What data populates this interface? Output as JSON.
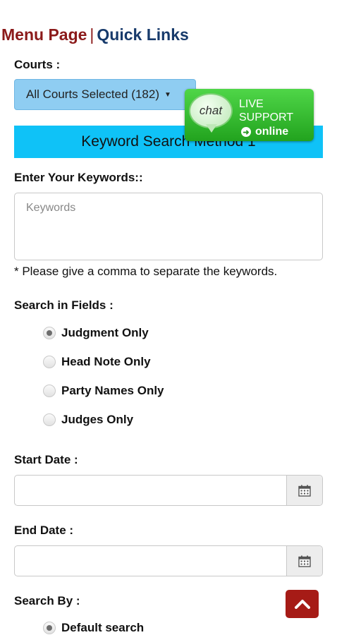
{
  "nav": {
    "menu_page": "Menu Page",
    "separator": "|",
    "quick_links": "Quick Links"
  },
  "courts": {
    "label": "Courts :",
    "selected": "All Courts Selected (182)"
  },
  "section_title": "Keyword Search Method 1",
  "chat": {
    "bubble": "chat",
    "live": "LIVE",
    "support": "SUPPORT",
    "status": "online"
  },
  "keywords": {
    "label": "Enter Your Keywords::",
    "placeholder": "Keywords",
    "hint": "* Please give a comma to separate the keywords."
  },
  "fields": {
    "label": "Search in Fields :",
    "options": [
      {
        "label": "Judgment Only",
        "checked": true
      },
      {
        "label": "Head Note Only",
        "checked": false
      },
      {
        "label": "Party Names Only",
        "checked": false
      },
      {
        "label": "Judges Only",
        "checked": false
      }
    ]
  },
  "start_date": {
    "label": "Start Date :",
    "value": ""
  },
  "end_date": {
    "label": "End Date :",
    "value": ""
  },
  "search_by": {
    "label": "Search By :",
    "options": [
      {
        "label": "Default search",
        "checked": true
      }
    ]
  },
  "colors": {
    "brand_red": "#8b1a1a",
    "brand_navy": "#173a6b",
    "section_cyan": "#0fc2f7",
    "chat_green": "#2fbf2a",
    "scroll_top_red": "#a61b16"
  },
  "icons": {
    "calendar": "calendar-icon",
    "scroll_top": "chevron-up-icon",
    "online": "arrow-right-circle-icon"
  }
}
